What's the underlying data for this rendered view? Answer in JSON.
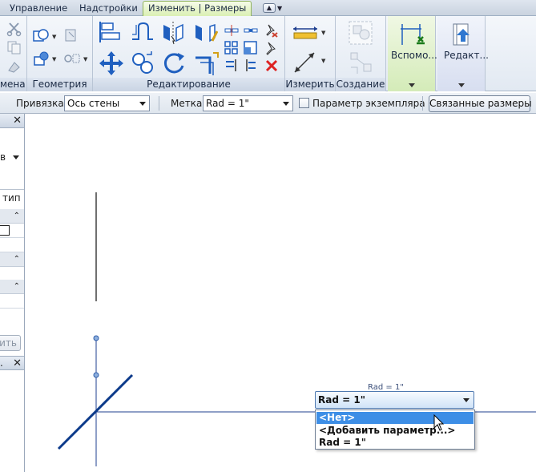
{
  "ribbon_tabs": {
    "manage": "Управление",
    "addins": "Надстройки",
    "modify_dims": "Изменить | Размеры"
  },
  "qat": {
    "icon": "quick-access-toggle-icon",
    "symbol": "▲"
  },
  "panels": {
    "clipboard_cut": "мена",
    "geometry": "Геометрия",
    "modify": "Редактирование",
    "measure": "Измерить",
    "create": "Создание",
    "helper": "Вспомо...",
    "edit": "Редакт..."
  },
  "options_bar": {
    "snap_label": "Привязка:",
    "snap_value": "Ось стены",
    "tag_label": "Метка:",
    "tag_value": "Rad = 1\"",
    "instance_param_label": "Параметр экземпляра",
    "linked_dims_button": "Связанные размеры",
    "instance_param_checked": false
  },
  "palette": {
    "row_letter": "в",
    "type_label": "тип",
    "apply_button_text": "ить"
  },
  "canvas": {
    "dim_tag_text": "Rad = 1\"",
    "label_dropdown": {
      "selected": "Rad = 1\"",
      "options": [
        "<Нет>",
        "<Добавить параметр...>",
        "Rad = 1\""
      ],
      "highlighted_index": 0
    }
  },
  "colors": {
    "ribbon_green_panel": "#d4ebb8",
    "selection_blue": "#3d8ee6",
    "dimension_line": "#1f3f8f",
    "wall_line": "#0c3a8a"
  }
}
